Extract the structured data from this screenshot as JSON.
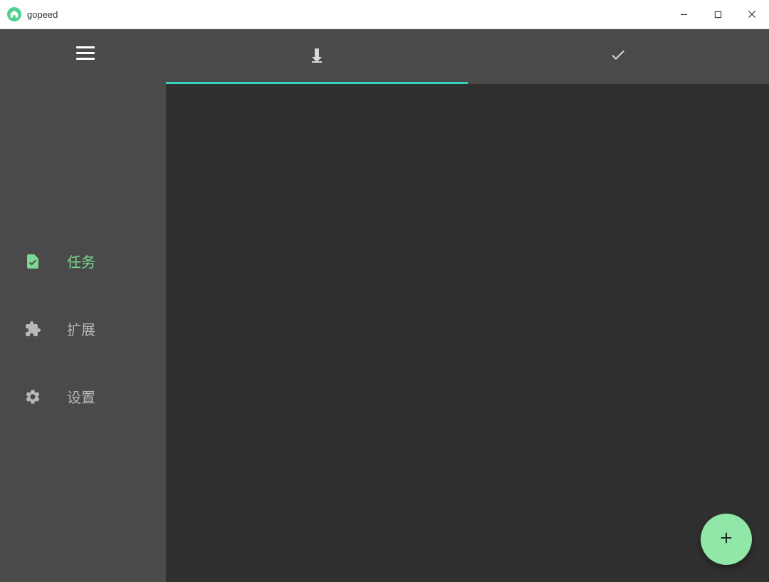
{
  "window": {
    "title": "gopeed"
  },
  "sidebar": {
    "items": [
      {
        "label": "任务",
        "icon": "file-check-icon",
        "active": true
      },
      {
        "label": "扩展",
        "icon": "puzzle-icon",
        "active": false
      },
      {
        "label": "设置",
        "icon": "gear-icon",
        "active": false
      }
    ]
  },
  "tabs": [
    {
      "icon": "download-icon",
      "active": true
    },
    {
      "icon": "check-icon",
      "active": false
    }
  ],
  "fab": {
    "icon": "plus-icon"
  },
  "colors": {
    "accent_tab": "#34d1bb",
    "accent_green": "#7cd892",
    "fab_bg": "#90e7a7",
    "sidebar_bg": "#4a4a4a",
    "content_bg": "#303030"
  }
}
